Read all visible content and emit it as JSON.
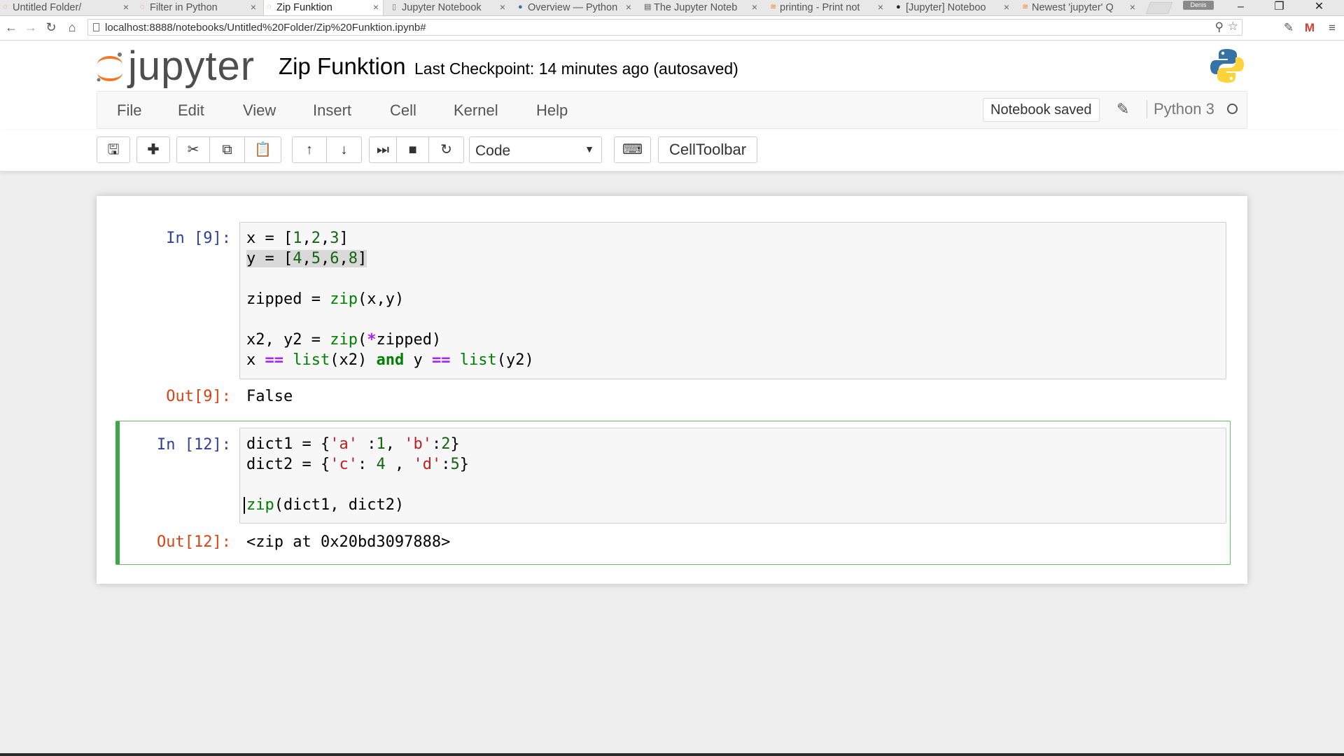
{
  "browser": {
    "tabs": [
      {
        "label": "Untitled Folder/",
        "icon": "jupyter-icon"
      },
      {
        "label": "Filter in Python",
        "icon": "jupyter-icon"
      },
      {
        "label": "Zip Funktion",
        "icon": "jupyter-icon",
        "active": true
      },
      {
        "label": "Jupyter Notebook",
        "icon": "doc-icon"
      },
      {
        "label": "Overview — Python",
        "icon": "python-icon"
      },
      {
        "label": "The Jupyter Noteb",
        "icon": "book-icon"
      },
      {
        "label": "printing - Print not",
        "icon": "stack-icon"
      },
      {
        "label": "[Jupyter] Noteboo",
        "icon": "github-icon"
      },
      {
        "label": "Newest 'jupyter' Q",
        "icon": "stack-icon"
      }
    ],
    "close_glyph": "×",
    "profile_label": "Denis",
    "url": "localhost:8888/notebooks/Untitled%20Folder/Zip%20Funktion.ipynb#"
  },
  "jupyter": {
    "logo_text": "jupyter",
    "notebook_name": "Zip Funktion",
    "checkpoint": "Last Checkpoint: 14 minutes ago (autosaved)",
    "menu": [
      "File",
      "Edit",
      "View",
      "Insert",
      "Cell",
      "Kernel",
      "Help"
    ],
    "notification": "Notebook saved",
    "kernel": "Python 3",
    "cell_type": "Code",
    "celltoolbar_label": "CellToolbar"
  },
  "cells": [
    {
      "in_prompt": "In [9]:",
      "out_prompt": "Out[9]:",
      "output": "False"
    },
    {
      "in_prompt": "In [12]:",
      "out_prompt": "Out[12]:",
      "output": "<zip at 0x20bd3097888>"
    }
  ],
  "colors": {
    "accent_orange": "#f37726",
    "in_prompt": "#303f9f",
    "out_prompt": "#d84315",
    "selected_border": "#42a54b"
  }
}
